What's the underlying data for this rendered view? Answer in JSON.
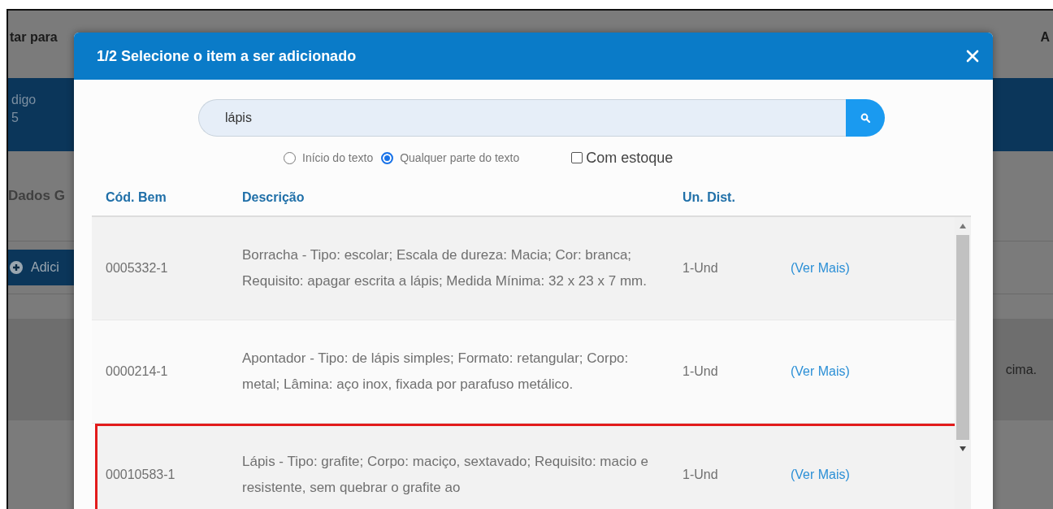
{
  "background": {
    "toolbar_text": "tar para",
    "toolbar_text_right": "A",
    "header_label": "digo",
    "header_value": "5",
    "section_title": "Dados G",
    "add_button": "Adici",
    "message": "cima."
  },
  "dialog": {
    "title": "1/2 Selecione o item a ser adicionado",
    "search": {
      "value": "lápis"
    },
    "match_options": [
      {
        "label": "Início do texto",
        "selected": false
      },
      {
        "label": "Qualquer parte do texto",
        "selected": true
      }
    ],
    "in_stock": {
      "label": "Com estoque",
      "checked": false
    },
    "table": {
      "columns": [
        "Cód. Bem",
        "Descrição",
        "Un. Dist."
      ],
      "rows": [
        {
          "code": "0005332-1",
          "description": "Borracha - Tipo: escolar; Escala de dureza: Macia; Cor: branca; Requisito: apagar escrita a lápis; Medida Mínima: 32 x 23 x 7 mm.",
          "unit": "1-Und",
          "link": "(Ver Mais)",
          "highlighted": false
        },
        {
          "code": "0000214-1",
          "description": "Apontador - Tipo: de lápis simples; Formato: retangular; Corpo: metal; Lâmina: aço inox, fixada por parafuso metálico.",
          "unit": "1-Und",
          "link": "(Ver Mais)",
          "highlighted": false
        },
        {
          "code": "00010583-1",
          "description": "Lápis - Tipo: grafite; Corpo: maciço, sextavado; Requisito: macio e resistente, sem quebrar o grafite ao",
          "unit": "1-Und",
          "link": "(Ver Mais)",
          "highlighted": true
        }
      ]
    }
  }
}
